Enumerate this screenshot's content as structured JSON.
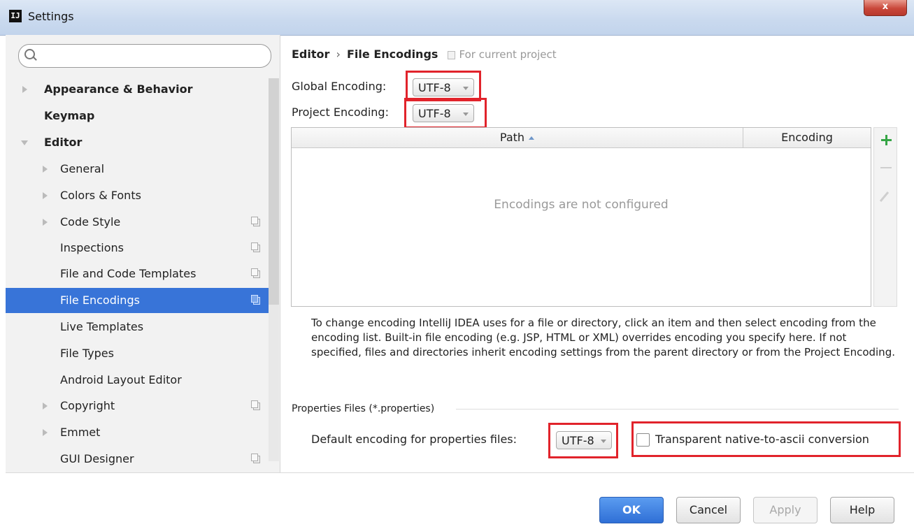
{
  "window": {
    "title": "Settings",
    "app_icon_text": "IJ",
    "close_label": "x"
  },
  "sidebar": {
    "search_placeholder": "",
    "items": [
      {
        "label": "Appearance & Behavior",
        "bold": true
      },
      {
        "label": "Keymap",
        "bold": true
      },
      {
        "label": "Editor",
        "bold": true
      },
      {
        "label": "General"
      },
      {
        "label": "Colors & Fonts"
      },
      {
        "label": "Code Style"
      },
      {
        "label": "Inspections"
      },
      {
        "label": "File and Code Templates"
      },
      {
        "label": "File Encodings",
        "selected": true
      },
      {
        "label": "Live Templates"
      },
      {
        "label": "File Types"
      },
      {
        "label": "Android Layout Editor"
      },
      {
        "label": "Copyright"
      },
      {
        "label": "Emmet"
      },
      {
        "label": "GUI Designer"
      }
    ]
  },
  "content": {
    "breadcrumb": {
      "parent": "Editor",
      "separator": "›",
      "current": "File Encodings",
      "note": "For current project"
    },
    "global_encoding": {
      "label": "Global Encoding:",
      "value": "UTF-8"
    },
    "project_encoding": {
      "label": "Project Encoding:",
      "value": "UTF-8"
    },
    "table": {
      "columns": [
        "Path",
        "Encoding"
      ],
      "empty_text": "Encodings are not configured"
    },
    "help_text": "To change encoding IntelliJ IDEA uses for a file or directory, click an item and then select encoding from the encoding list. Built-in file encoding (e.g. JSP, HTML or XML) overrides encoding you specify here. If not specified, files and directories inherit encoding settings from the parent directory or from the Project Encoding.",
    "properties": {
      "group_title": "Properties Files (*.properties)",
      "default_label": "Default encoding for properties files:",
      "default_value": "UTF-8",
      "transparent_label": "Transparent native-to-ascii conversion",
      "transparent_checked": false
    }
  },
  "buttons": {
    "ok": "OK",
    "cancel": "Cancel",
    "apply": "Apply",
    "help": "Help"
  },
  "colors": {
    "selection": "#3874d8",
    "highlight_box": "#e1232b",
    "add_icon": "#35a545",
    "primary_button": "#2f6fd6"
  }
}
